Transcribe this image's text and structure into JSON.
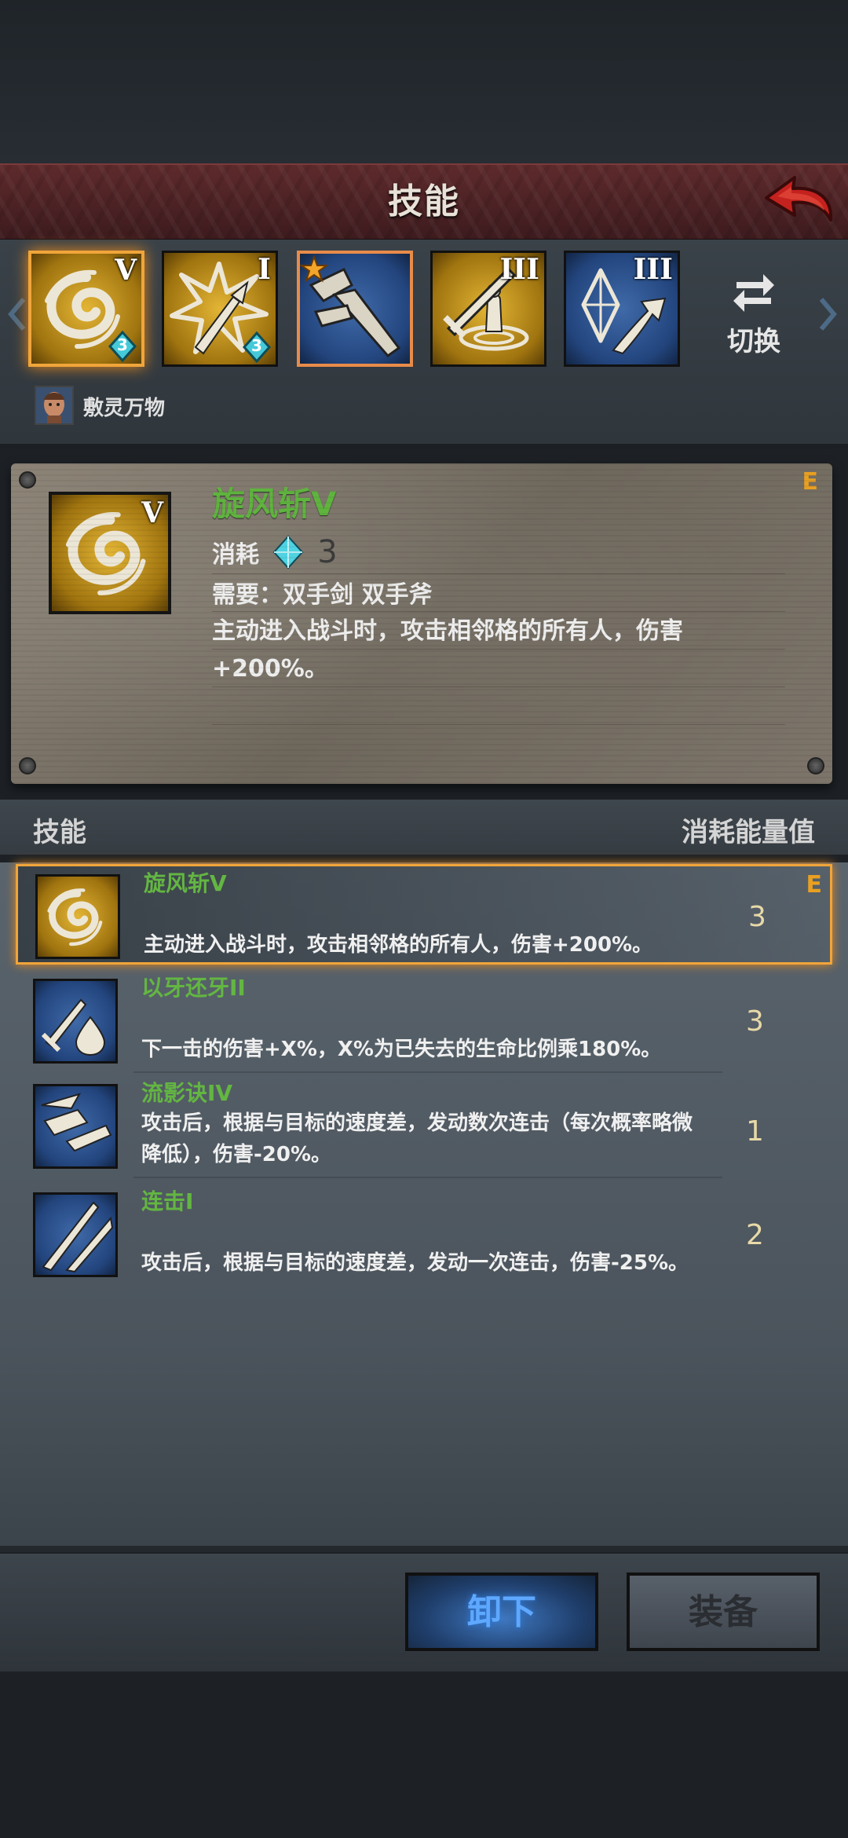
{
  "header": {
    "title": "技能"
  },
  "skill_bar": {
    "slots": [
      {
        "roman": "V",
        "badge": "3",
        "color": "gold",
        "icon": "whirlwind-icon",
        "selected": true
      },
      {
        "roman": "I",
        "badge": "3",
        "color": "gold",
        "icon": "burst-strike-icon"
      },
      {
        "roman": "",
        "star": true,
        "color": "blue",
        "icon": "blade-parts-icon"
      },
      {
        "roman": "III",
        "color": "gold",
        "icon": "sword-aura-icon"
      },
      {
        "roman": "III",
        "color": "blue",
        "icon": "crystal-dash-icon"
      }
    ],
    "switch_label": "切换",
    "character_name": "敷灵万物"
  },
  "detail": {
    "name": "旋风斩V",
    "grade": "E",
    "cost_label": "消耗",
    "cost_value": "3",
    "requirement": "需要：双手剑  双手斧",
    "description": "主动进入战斗时，攻击相邻格的所有人，伤害+200%。"
  },
  "list_header": {
    "left": "技能",
    "right": "消耗能量值"
  },
  "skills": [
    {
      "name": "旋风斩V",
      "description": "主动进入战斗时，攻击相邻格的所有人，伤害+200%。",
      "cost": "3",
      "grade": "E",
      "selected": true,
      "icon": "whirlwind-icon"
    },
    {
      "name": "以牙还牙II",
      "description": "下一击的伤害+X%，X%为已失去的生命比例乘180%。",
      "cost": "3",
      "icon": "blood-sword-icon"
    },
    {
      "name": "流影诀IV",
      "description": "攻击后，根据与目标的速度差，发动数次连击（每次概率略微降低），伤害-20%。",
      "cost": "1",
      "icon": "shadow-blade-icon"
    },
    {
      "name": "连击I",
      "description": "攻击后，根据与目标的速度差，发动一次连击，伤害-25%。",
      "cost": "2",
      "icon": "combo-strike-icon"
    }
  ],
  "buttons": {
    "unequip": "卸下",
    "equip": "装备"
  },
  "colors": {
    "skill_name": "#63b642",
    "grade": "#e9a021",
    "highlight": "#f0a53a",
    "header": "#5e2a2c"
  }
}
